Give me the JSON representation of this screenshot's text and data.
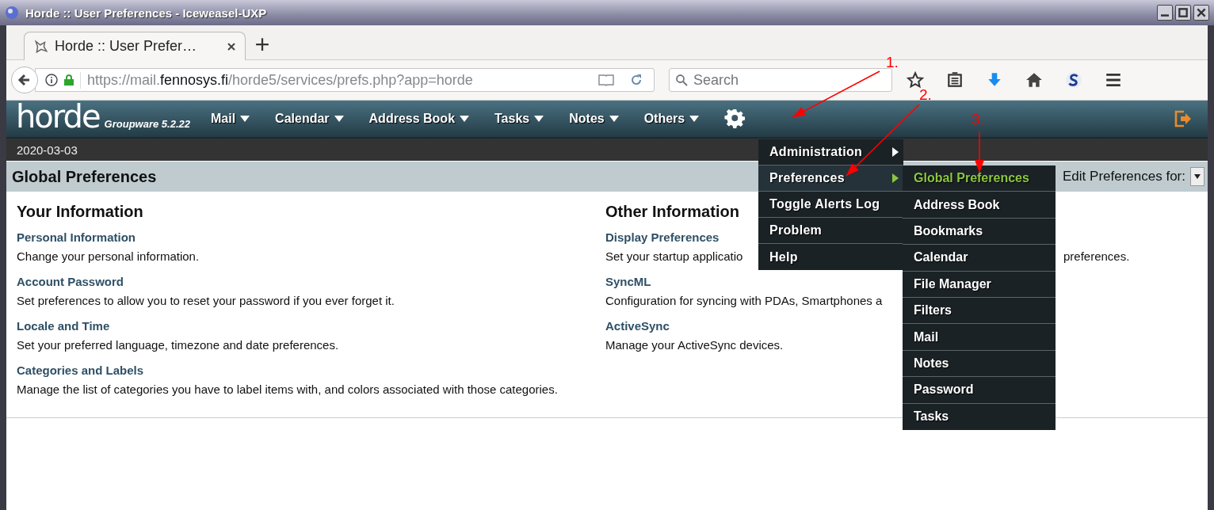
{
  "window": {
    "title": "Horde :: User Preferences - Iceweasel-UXP"
  },
  "tabs": [
    {
      "label": "Horde :: User Prefer…",
      "selected": true
    }
  ],
  "address_bar": {
    "url_prefix": "https://mail.",
    "url_domain": "fennosys.fi",
    "url_path": "/horde5/services/prefs.php?app=horde"
  },
  "search": {
    "placeholder": "Search"
  },
  "app": {
    "logo": "horde",
    "product": "Groupware 5.2.22",
    "date": "2020-03-03",
    "menu": [
      {
        "label": "Mail"
      },
      {
        "label": "Calendar"
      },
      {
        "label": "Address Book"
      },
      {
        "label": "Tasks"
      },
      {
        "label": "Notes"
      },
      {
        "label": "Others"
      }
    ]
  },
  "page_title": "Global Preferences",
  "edit_prefs_label": "Edit Preferences for:",
  "sections": [
    {
      "title": "Your Information",
      "items": [
        {
          "link": "Personal Information",
          "description": "Change your personal information."
        },
        {
          "link": "Account Password",
          "description": "Set preferences to allow you to reset your password if you ever forget it."
        },
        {
          "link": "Locale and Time",
          "description": "Set your preferred language, timezone and date preferences."
        },
        {
          "link": "Categories and Labels",
          "description": "Manage the list of categories you have to label items with, and colors associated with those categories."
        }
      ]
    },
    {
      "title": "Other Information",
      "items": [
        {
          "link": "Display Preferences",
          "description": "Set your startup applicatio",
          "description_tail": "preferences."
        },
        {
          "link": "SyncML",
          "description": "Configuration for syncing with PDAs, Smartphones a"
        },
        {
          "link": "ActiveSync",
          "description": "Manage your ActiveSync devices."
        }
      ]
    }
  ],
  "dropdown_menu": {
    "items": [
      {
        "label": "Administration",
        "has_submenu": true,
        "selected": false
      },
      {
        "label": "Preferences",
        "has_submenu": true,
        "selected": true
      },
      {
        "label": "Toggle Alerts Log",
        "has_submenu": false,
        "selected": false
      },
      {
        "label": "Problem",
        "has_submenu": false,
        "selected": false
      },
      {
        "label": "Help",
        "has_submenu": false,
        "selected": false
      }
    ]
  },
  "submenu": {
    "items": [
      {
        "label": "Global Preferences",
        "selected": true
      },
      {
        "label": "Address Book",
        "selected": false
      },
      {
        "label": "Bookmarks",
        "selected": false
      },
      {
        "label": "Calendar",
        "selected": false
      },
      {
        "label": "File Manager",
        "selected": false
      },
      {
        "label": "Filters",
        "selected": false
      },
      {
        "label": "Mail",
        "selected": false
      },
      {
        "label": "Notes",
        "selected": false
      },
      {
        "label": "Password",
        "selected": false
      },
      {
        "label": "Tasks",
        "selected": false
      }
    ]
  },
  "annotations": [
    {
      "label": "1."
    },
    {
      "label": "2."
    },
    {
      "label": "3."
    }
  ]
}
